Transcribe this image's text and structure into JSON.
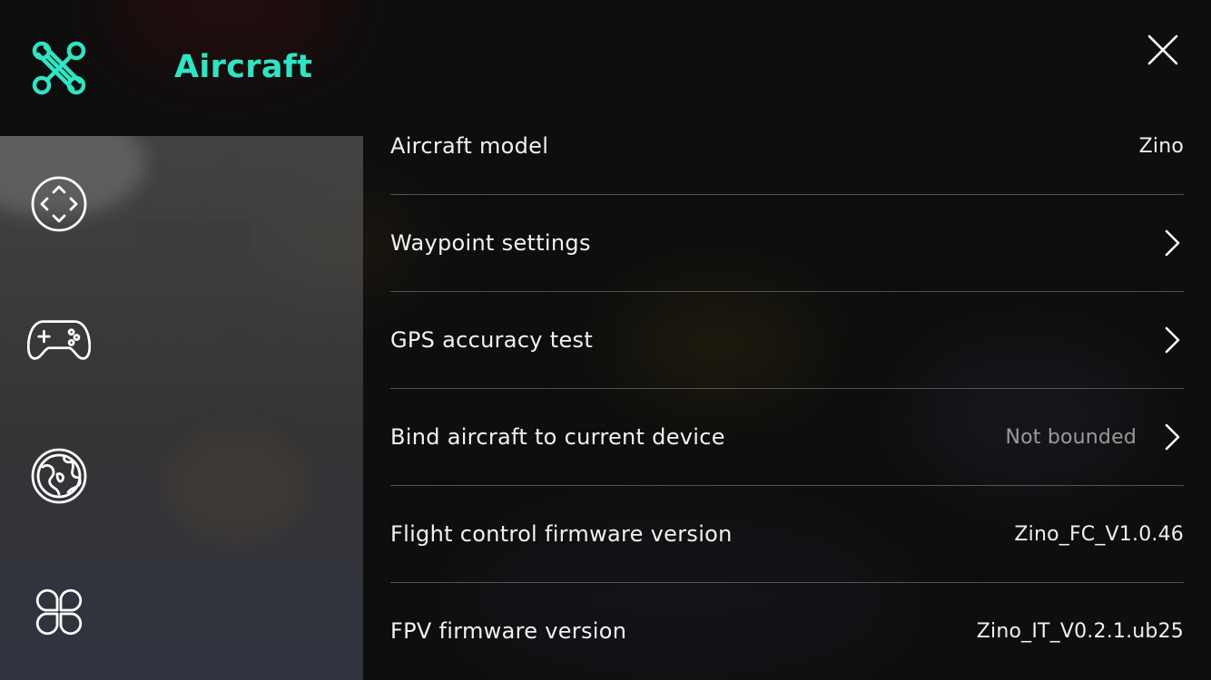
{
  "header": {
    "title": "Aircraft",
    "logo_icon": "aircraft-icon",
    "close_icon": "close-icon",
    "accent": "#2fe4c2"
  },
  "sidebar": {
    "items": [
      {
        "name": "gimbal-control",
        "icon": "dpad-circle-icon"
      },
      {
        "name": "remote-controller",
        "icon": "gamepad-icon"
      },
      {
        "name": "map-settings",
        "icon": "globe-icon"
      },
      {
        "name": "general-settings",
        "icon": "clover-icon"
      }
    ]
  },
  "settings": {
    "rows": [
      {
        "label": "Aircraft model",
        "value": "Zino",
        "has_chevron": false
      },
      {
        "label": "Waypoint settings",
        "value": "",
        "has_chevron": true
      },
      {
        "label": "GPS accuracy test",
        "value": "",
        "has_chevron": true
      },
      {
        "label": "Bind aircraft to current device",
        "value": "Not bounded",
        "has_chevron": true
      },
      {
        "label": "Flight control firmware version",
        "value": "Zino_FC_V1.0.46",
        "has_chevron": false
      },
      {
        "label": "FPV firmware version",
        "value": "Zino_IT_V0.2.1.ub25",
        "has_chevron": false
      }
    ]
  }
}
